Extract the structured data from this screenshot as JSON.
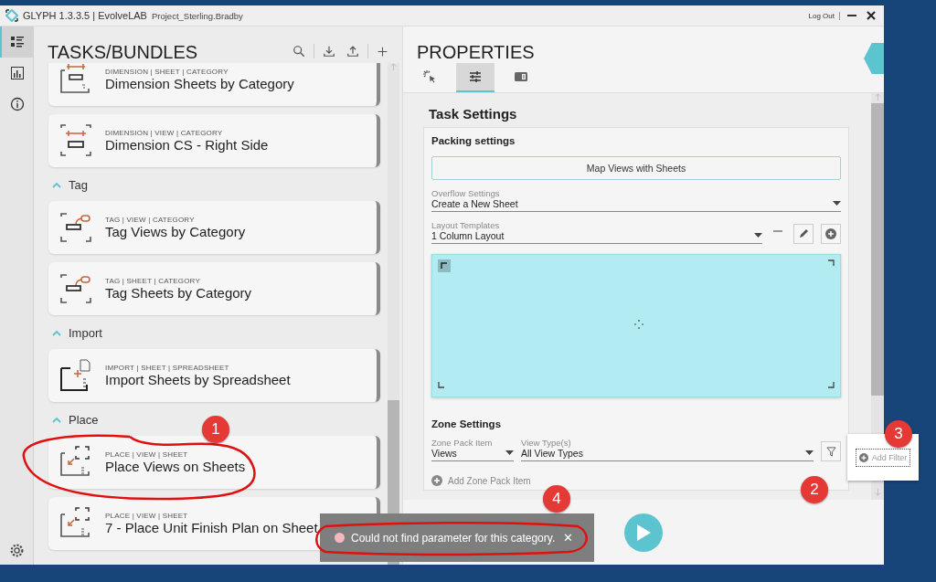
{
  "title_bar": {
    "app": "GLYPH 1.3.3.5 | EvolveLAB",
    "project": "Project_Sterling.Bradby",
    "logout": "Log Out"
  },
  "rail": [
    {
      "kind": "list",
      "selected": true
    },
    {
      "kind": "chart",
      "selected": false
    },
    {
      "kind": "info",
      "selected": false
    }
  ],
  "tasks": {
    "title": "TASKS/BUNDLES",
    "top_items": [
      {
        "kind": "dimension-sheet",
        "tags": "DIMENSION | SHEET | CATEGORY",
        "name": "Dimension Sheets by Category"
      },
      {
        "kind": "dimension-view",
        "tags": "DIMENSION | VIEW | CATEGORY",
        "name": "Dimension CS - Right Side"
      }
    ],
    "groups": [
      {
        "label": "Tag",
        "expanded": true,
        "items": [
          {
            "kind": "tag",
            "tags": "TAG | VIEW | CATEGORY",
            "name": "Tag Views by Category"
          },
          {
            "kind": "tag",
            "tags": "TAG | SHEET | CATEGORY",
            "name": "Tag Sheets by Category"
          }
        ]
      },
      {
        "label": "Import",
        "expanded": true,
        "items": [
          {
            "kind": "import",
            "tags": "IMPORT | SHEET | SPREADSHEET",
            "name": "Import Sheets by Spreadsheet"
          }
        ]
      },
      {
        "label": "Place",
        "expanded": true,
        "items": [
          {
            "kind": "place",
            "tags": "PLACE | VIEW | SHEET",
            "name": "Place Views on Sheets",
            "annotation": "1",
            "circled": true
          },
          {
            "kind": "place",
            "tags": "PLACE | VIEW | SHEET",
            "name": "7 - Place Unit Finish Plan on Sheet"
          }
        ]
      }
    ]
  },
  "properties": {
    "title": "PROPERTIES",
    "tabs": [
      {
        "kind": "select",
        "selected": false
      },
      {
        "kind": "settings",
        "selected": true
      },
      {
        "kind": "panel",
        "selected": false
      }
    ],
    "section_title": "Task Settings",
    "packing": {
      "title": "Packing settings",
      "map_button": "Map Views with Sheets",
      "overflow": {
        "label": "Overflow Settings",
        "value": "Create a New Sheet"
      },
      "layout": {
        "label": "Layout Templates",
        "value": "1 Column Layout"
      }
    },
    "zone": {
      "title": "Zone Settings",
      "pack_item": {
        "label": "Zone Pack Item",
        "value": "Views"
      },
      "view_types": {
        "label": "View Type(s)",
        "value": "All View Types"
      },
      "filter_annotation": "2",
      "add_item": "Add Zone Pack Item"
    }
  },
  "add_filter": {
    "label": "Add Filter",
    "annotation": "3"
  },
  "toast": {
    "message": "Could not find parameter for this category.",
    "close": "✕",
    "annotation": "4",
    "circled": true
  }
}
